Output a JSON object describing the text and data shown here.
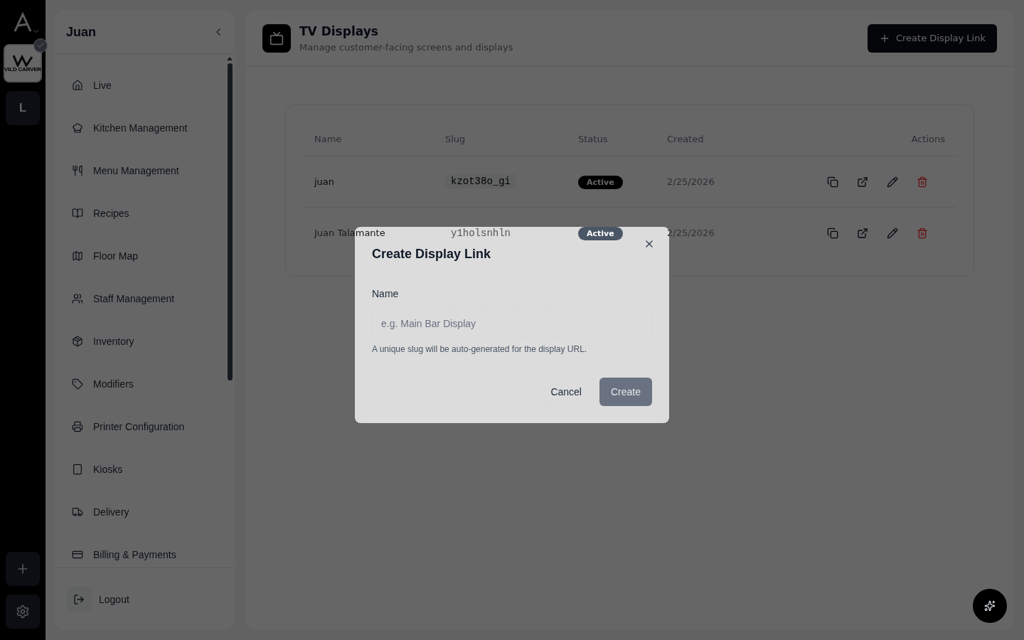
{
  "rail": {
    "org_logo_text": "VILD CARVER",
    "org_selected": true,
    "other_org": "L"
  },
  "sidebar": {
    "title": "Juan",
    "items": [
      {
        "label": "Live"
      },
      {
        "label": "Kitchen Management"
      },
      {
        "label": "Menu Management"
      },
      {
        "label": "Recipes"
      },
      {
        "label": "Floor Map"
      },
      {
        "label": "Staff Management"
      },
      {
        "label": "Inventory"
      },
      {
        "label": "Modifiers"
      },
      {
        "label": "Printer Configuration"
      },
      {
        "label": "Kiosks"
      },
      {
        "label": "Delivery"
      },
      {
        "label": "Billing & Payments"
      }
    ],
    "logout": "Logout"
  },
  "header": {
    "title": "TV Displays",
    "subtitle": "Manage customer-facing screens and displays",
    "button": "Create Display Link"
  },
  "table": {
    "columns": [
      "Name",
      "Slug",
      "Status",
      "Created",
      "Actions"
    ],
    "rows": [
      {
        "name": "juan",
        "slug": "kzot38o_gi",
        "status": "Active",
        "created": "2/25/2026"
      },
      {
        "name": "Juan Talamante",
        "slug": "y1holsnhln",
        "status": "Active",
        "created": "2/25/2026"
      }
    ]
  },
  "dialog": {
    "title": "Create Display Link",
    "field_label": "Name",
    "placeholder": "e.g. Main Bar Display",
    "hint": "A unique slug will be auto-generated for the display URL.",
    "cancel": "Cancel",
    "create": "Create",
    "create_disabled": true
  }
}
